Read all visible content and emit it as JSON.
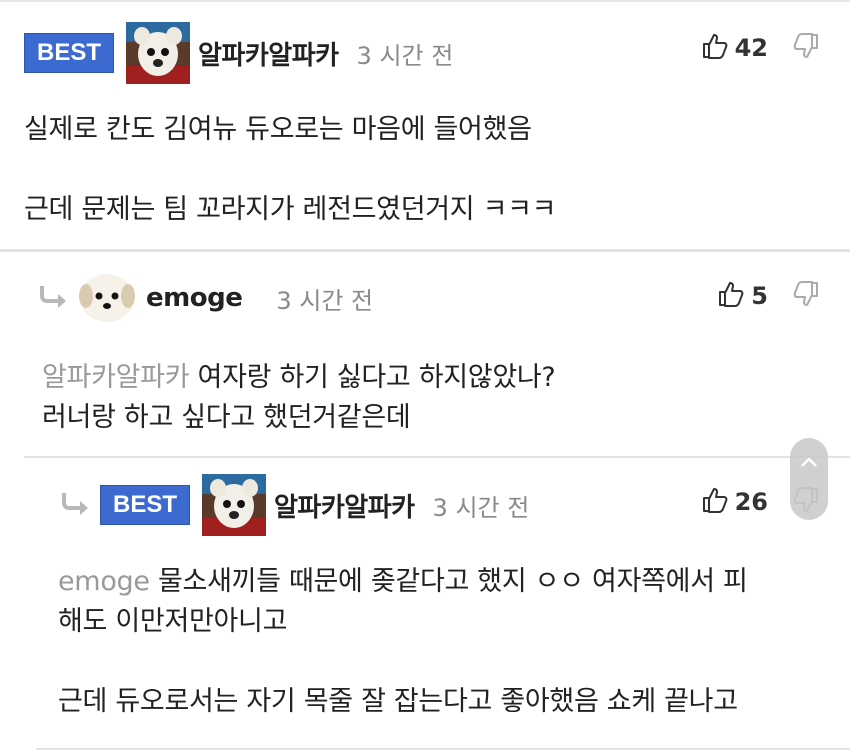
{
  "comments": [
    {
      "badge": "BEST",
      "nickname": "알파카알파카",
      "time": "3 시간 전",
      "likes": "42",
      "lines": [
        "실제로 칸도 김여뉴 듀오로는 마음에 들어했음",
        "",
        "근데 문제는 팀 꼬라지가 레전드였던거지 ㅋㅋㅋ"
      ]
    },
    {
      "nickname": "emoge",
      "time": "3 시간 전",
      "likes": "5",
      "mention": "알파카알파카",
      "lines": [
        "여자랑 하기 싫다고 하지않았나?",
        "러너랑 하고 싶다고 했던거같은데"
      ]
    },
    {
      "badge": "BEST",
      "nickname": "알파카알파카",
      "time": "3 시간 전",
      "likes": "26",
      "mention": "emoge",
      "lines": [
        "물소새끼들 때문에 좆같다고 했지 ㅇㅇ 여자쪽에서 피",
        "해도 이만저만아니고",
        "",
        "근데 듀오로서는 자기 목줄 잘 잡는다고 좋아했음 쇼케 끝나고"
      ]
    }
  ],
  "icons": {
    "like": "thumbs-up-icon",
    "dislike": "thumbs-down-icon",
    "reply": "reply-arrow-icon",
    "scroll": "chevron-up-icon"
  },
  "colors": {
    "badge": "#3c6ad0",
    "meta": "#8a8a8a",
    "mention": "#9a9a9a"
  }
}
